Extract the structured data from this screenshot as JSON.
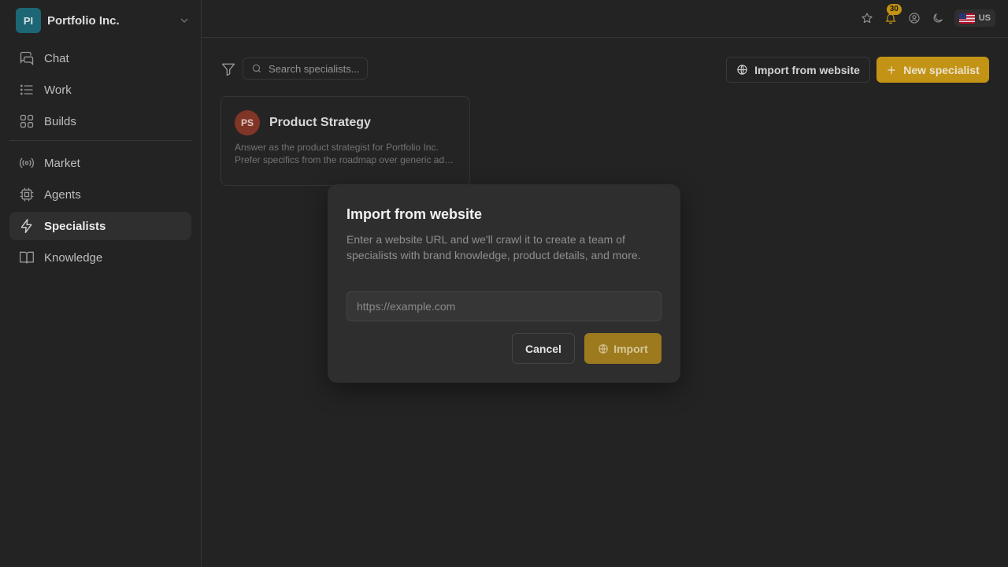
{
  "sidebar": {
    "org": {
      "initials": "PI",
      "name": "Portfolio Inc."
    },
    "items_primary": [
      {
        "label": "Chat",
        "icon": "chat-icon"
      },
      {
        "label": "Work",
        "icon": "list-icon"
      },
      {
        "label": "Builds",
        "icon": "grid-icon"
      }
    ],
    "items_secondary": [
      {
        "label": "Market",
        "icon": "broadcast-icon"
      },
      {
        "label": "Agents",
        "icon": "chip-icon"
      },
      {
        "label": "Specialists",
        "icon": "lightning-icon",
        "active": true
      },
      {
        "label": "Knowledge",
        "icon": "book-icon"
      }
    ]
  },
  "topbar": {
    "notification_count": "30",
    "locale": "US"
  },
  "toolbar": {
    "search_placeholder": "Search specialists...",
    "import_label": "Import from website",
    "new_label": "New specialist"
  },
  "specialists": [
    {
      "initials": "PS",
      "name": "Product Strategy",
      "desc_line1": "Answer as the product strategist for Portfolio Inc.",
      "desc_line2": "Prefer specifics from the roadmap over generic advice."
    }
  ],
  "modal": {
    "title": "Import from website",
    "description": "Enter a website URL and we'll crawl it to create a team of specialists with brand knowledge, product details, and more.",
    "url_placeholder": "https://example.com",
    "url_value": "",
    "cancel_label": "Cancel",
    "import_label": "Import"
  },
  "colors": {
    "accent": "#d4a017",
    "background": "#262626",
    "modal": "#2e2e2e"
  }
}
